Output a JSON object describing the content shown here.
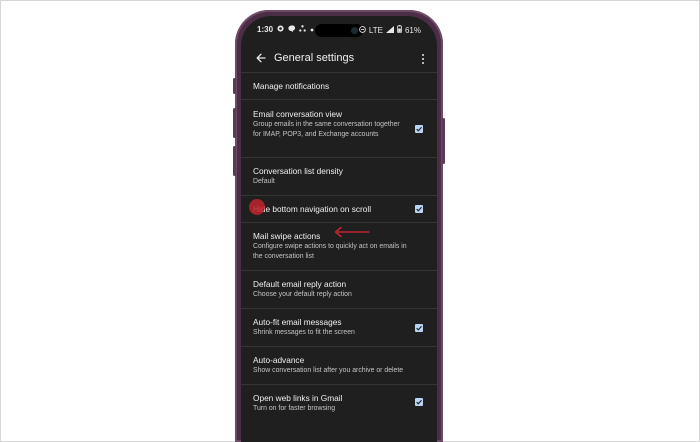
{
  "status_bar": {
    "time": "1:30",
    "network": "LTE",
    "battery": "61%"
  },
  "app_bar": {
    "title": "General settings",
    "back_icon": "arrow-back-icon",
    "menu_icon": "more-vert-icon"
  },
  "settings": [
    {
      "title": "Manage notifications",
      "subtitle": "",
      "checkbox": false
    },
    {
      "title": "Email conversation view",
      "subtitle": "Group emails in the same conversation together for IMAP, POP3, and Exchange accounts",
      "checkbox": true,
      "checked": true
    },
    {
      "title": "Conversation list density",
      "subtitle": "Default",
      "checkbox": false
    },
    {
      "title": "Hide bottom navigation on scroll",
      "subtitle": "",
      "checkbox": true,
      "checked": true
    },
    {
      "title": "Mail swipe actions",
      "subtitle": "Configure swipe actions to quickly act on emails in the conversation list",
      "checkbox": false
    },
    {
      "title": "Default email reply action",
      "subtitle": "Choose your default reply action",
      "checkbox": false
    },
    {
      "title": "Auto-fit email messages",
      "subtitle": "Shrink messages to fit the screen",
      "checkbox": true,
      "checked": true
    },
    {
      "title": "Auto-advance",
      "subtitle": "Show conversation list after you archive or delete",
      "checkbox": false
    },
    {
      "title": "Open web links in Gmail",
      "subtitle": "Turn on for faster browsing",
      "checkbox": true,
      "checked": true
    }
  ],
  "colors": {
    "screen_bg": "#1f1f1f",
    "phone_frame": "#4b2e45",
    "checkbox": "#b9d3f4",
    "annotation_red": "#c0232e"
  }
}
